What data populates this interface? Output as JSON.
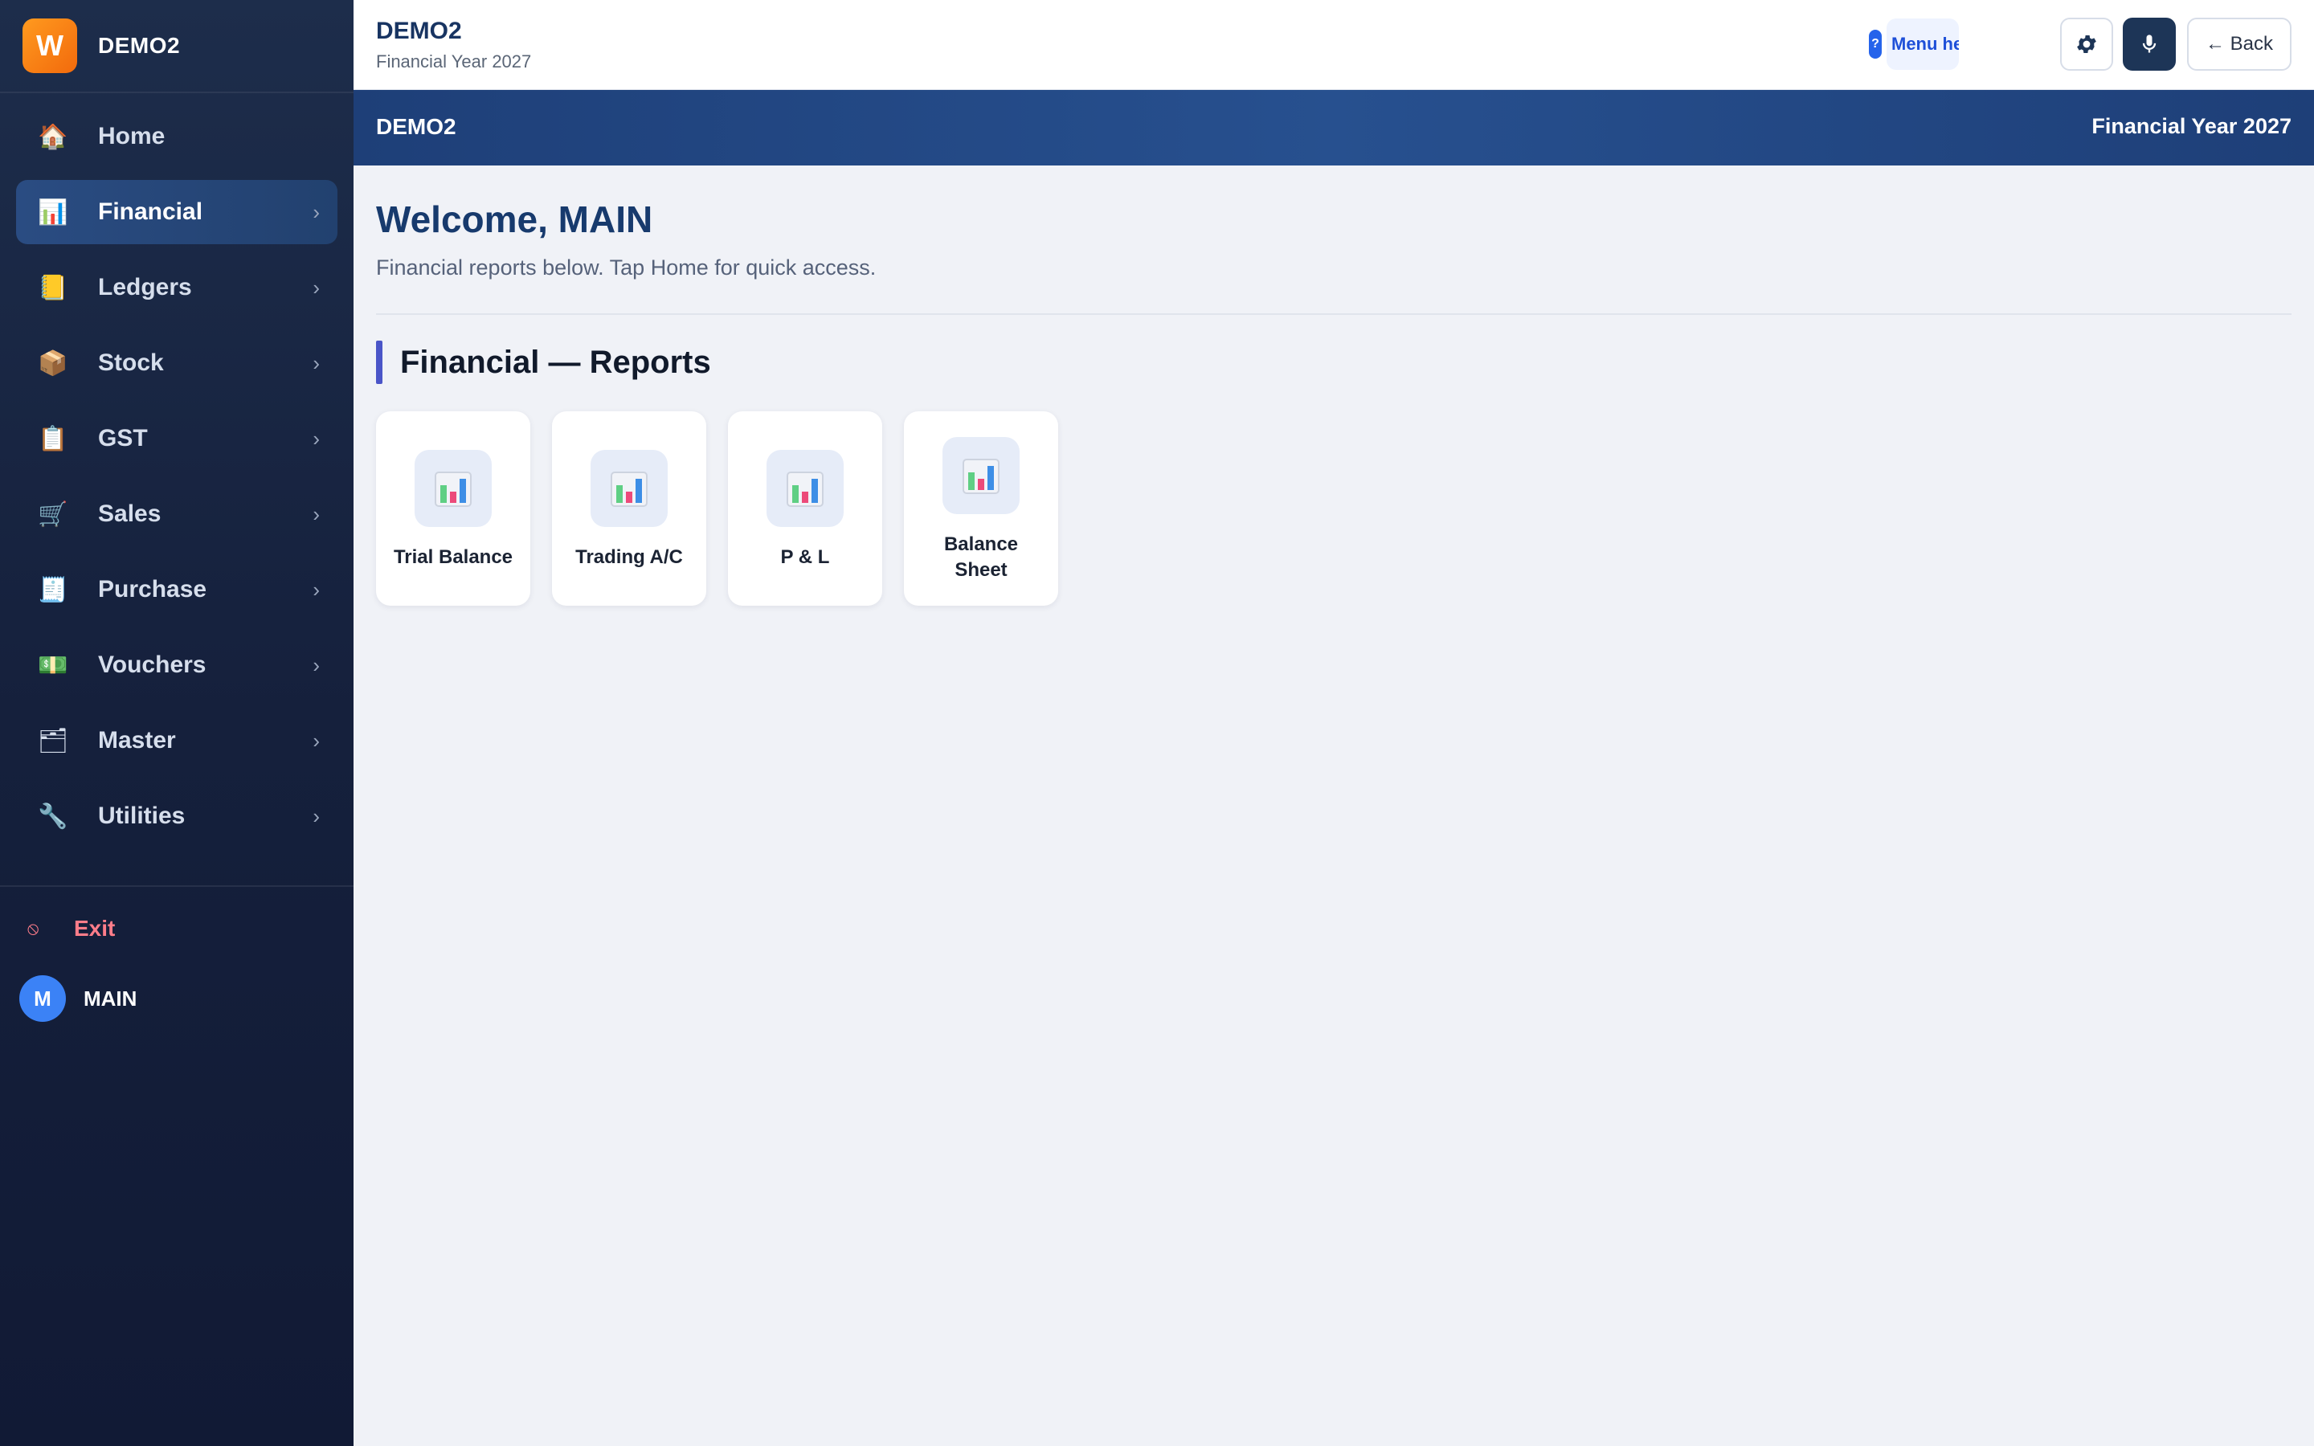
{
  "brand": {
    "logo_letter": "W",
    "name": "DEMO2"
  },
  "sidebar": {
    "items": [
      {
        "label": "Home",
        "icon": "house-icon",
        "glyph": "🏠",
        "chevron": ""
      },
      {
        "label": "Financial",
        "icon": "bar-chart-icon",
        "glyph": "📊",
        "chevron": "›",
        "active": true
      },
      {
        "label": "Ledgers",
        "icon": "ledger-icon",
        "glyph": "📒",
        "chevron": "›"
      },
      {
        "label": "Stock",
        "icon": "package-icon",
        "glyph": "📦",
        "chevron": "›"
      },
      {
        "label": "GST",
        "icon": "clipboard-icon",
        "glyph": "📋",
        "chevron": "›"
      },
      {
        "label": "Sales",
        "icon": "cart-icon",
        "glyph": "🛒",
        "chevron": "›"
      },
      {
        "label": "Purchase",
        "icon": "receipt-icon",
        "glyph": "🧾",
        "chevron": "›"
      },
      {
        "label": "Vouchers",
        "icon": "cash-icon",
        "glyph": "💵",
        "chevron": "›"
      },
      {
        "label": "Master",
        "icon": "folder-icon",
        "glyph": "🗂",
        "chevron": "›"
      },
      {
        "label": "Utilities",
        "icon": "wrench-icon",
        "glyph": "🔧",
        "chevron": "›"
      }
    ],
    "exit_label": "Exit",
    "exit_glyph": "⦸",
    "user": {
      "initial": "M",
      "name": "MAIN"
    }
  },
  "topbar": {
    "company": "DEMO2",
    "financial_year": "Financial Year 2027",
    "help_glyph": "?",
    "menu_help_label": "Menu help",
    "back_label": "← Back"
  },
  "strip": {
    "company": "DEMO2",
    "financial_year": "Financial Year 2027"
  },
  "main": {
    "welcome": "Welcome, MAIN",
    "subtitle": "Financial reports below. Tap Home for quick access.",
    "section_title": "Financial — Reports",
    "cards": [
      {
        "label": "Trial Balance",
        "icon": "bar-chart-icon"
      },
      {
        "label": "Trading A/C",
        "icon": "bar-chart-icon"
      },
      {
        "label": "P & L",
        "icon": "bar-chart-icon"
      },
      {
        "label": "Balance Sheet",
        "icon": "bar-chart-icon"
      }
    ]
  },
  "colors": {
    "sidebar_bg": "#15203c",
    "accent": "#4a55c8",
    "strip": "#27508f",
    "title": "#173a6d",
    "exit": "#ff7d8a"
  }
}
